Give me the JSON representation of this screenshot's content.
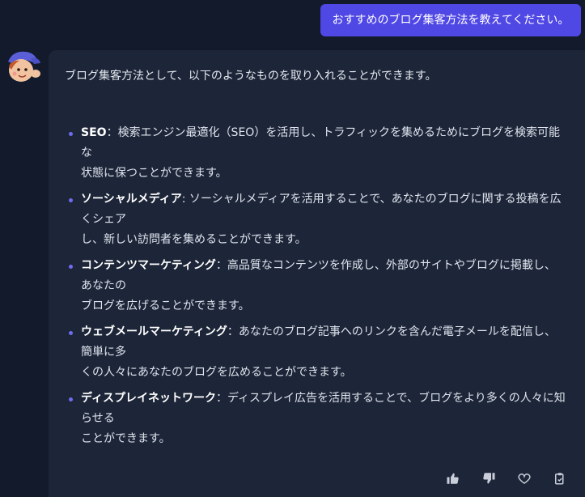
{
  "user_message": {
    "text": "おすすめのブログ集客方法を教えてください。",
    "color": "#5048e5"
  },
  "answer": {
    "intro": "ブログ集客方法として、以下のようなものを取り入れることができます。",
    "items": [
      {
        "term": "SEO",
        "separator": "：",
        "line1": "検索エンジン最適化（SEO）を活用し、トラフィックを集めるためにブログを検索可能な",
        "line2": "状態に保つことができます。"
      },
      {
        "term": "ソーシャルメディア",
        "separator": ":",
        "line1": "ソーシャルメディアを活用することで、あなたのブログに関する投稿を広くシェア",
        "line2": "し、新しい訪問者を集めることができます。"
      },
      {
        "term": "コンテンツマーケティング",
        "separator": "：",
        "line1": "高品質なコンテンツを作成し、外部のサイトやブログに掲載し、あなたの",
        "line2": "ブログを広げることができます。"
      },
      {
        "term": "ウェブメールマーケティング",
        "separator": "：",
        "line1": "あなたのブログ記事へのリンクを含んだ電子メールを配信し、簡単に多",
        "line2": "くの人々にあなたのブログを広めることができます。"
      },
      {
        "term": "ディスプレイネットワーク",
        "separator": "：",
        "line1": "ディスプレイ広告を活用することで、ブログをより多くの人々に知らせる",
        "line2": "ことができます。"
      }
    ]
  },
  "actions": {
    "icons": [
      "thumbs-up-icon",
      "thumbs-down-icon",
      "heart-icon",
      "copy-icon"
    ]
  },
  "colors": {
    "background": "#121a2c",
    "card": "#1d2638",
    "bullet": "#6f6cf0"
  }
}
